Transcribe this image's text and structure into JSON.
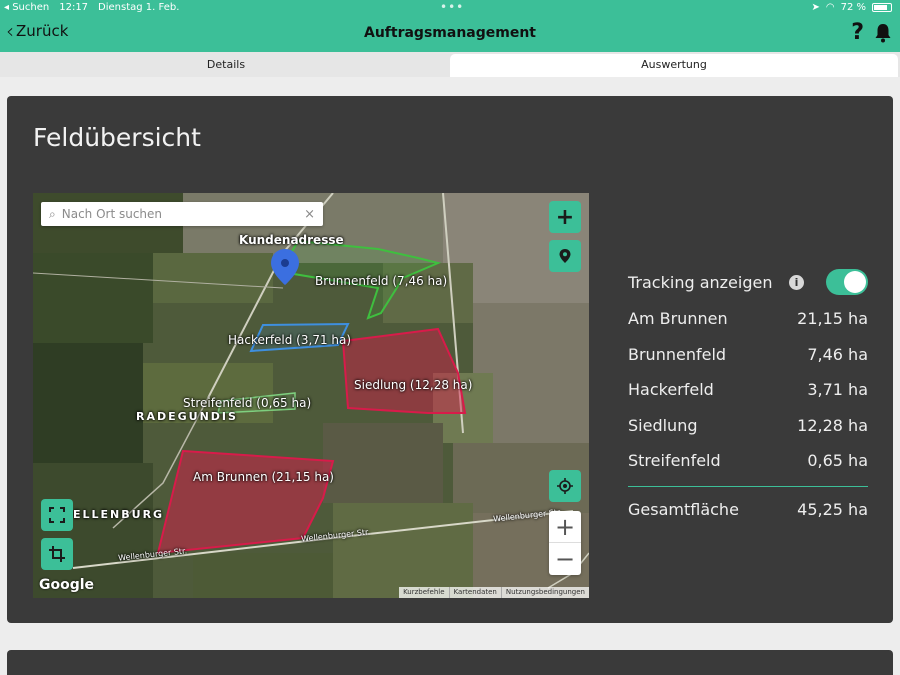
{
  "status": {
    "back_app": "◂ Suchen",
    "time": "12:17",
    "date": "Dienstag 1. Feb.",
    "battery": "72 %"
  },
  "nav": {
    "back_label": "Zurück",
    "title": "Auftragsmanagement"
  },
  "tabs": [
    {
      "label": "Details",
      "active": false
    },
    {
      "label": "Auswertung",
      "active": true
    }
  ],
  "card": {
    "title": "Feldübersicht"
  },
  "map": {
    "search_placeholder": "Nach Ort suchen",
    "pin_label": "Kundenadresse",
    "fields": [
      {
        "label": "Brunnenfeld (7,46 ha)",
        "color": "#3fbf3f"
      },
      {
        "label": "Hackerfeld (3,71 ha)",
        "color": "#3e8fe0"
      },
      {
        "label": "Siedlung (12,28 ha)",
        "color": "#d81b4a"
      },
      {
        "label": "Streifenfeld (0,65 ha)",
        "color": "#7fd07f"
      },
      {
        "label": "Am Brunnen (21,15 ha)",
        "color": "#d81b4a"
      }
    ],
    "places": [
      "RADEGUNDIS",
      "ELLENBURG"
    ],
    "streets": [
      "Wellenburger Str.",
      "Wellenburger Str.",
      "Wellenburger Str."
    ],
    "logo": "Google",
    "attribution": [
      "Kurzbefehle",
      "Kartendaten",
      "Nutzungsbedingungen"
    ],
    "zoom_in": "+",
    "zoom_out": "−"
  },
  "panel": {
    "tracking_label": "Tracking anzeigen",
    "tracking_on": true,
    "fields": [
      {
        "name": "Am Brunnen",
        "area": "21,15 ha"
      },
      {
        "name": "Brunnenfeld",
        "area": "7,46 ha"
      },
      {
        "name": "Hackerfeld",
        "area": "3,71 ha"
      },
      {
        "name": "Siedlung",
        "area": "12,28 ha"
      },
      {
        "name": "Streifenfeld",
        "area": "0,65 ha"
      }
    ],
    "total_label": "Gesamtfläche",
    "total_area": "45,25 ha"
  },
  "colors": {
    "accent": "#3cbf98",
    "card": "#3a3a3a"
  }
}
